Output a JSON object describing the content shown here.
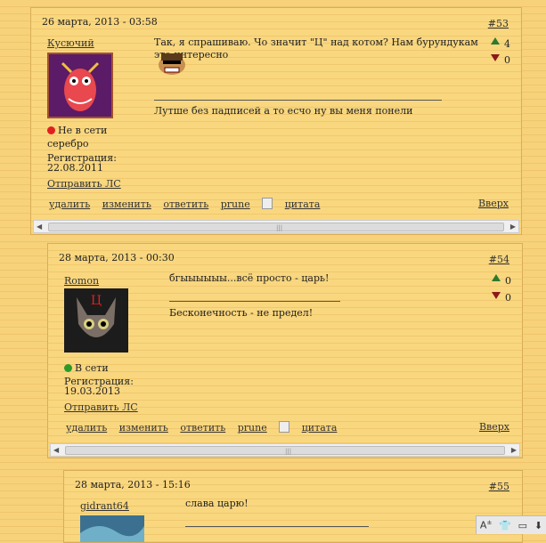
{
  "posts": [
    {
      "date": "26 марта, 2013 - 03:58",
      "number": "#53",
      "author": "Кусючий",
      "status": "Не в сети",
      "status_color": "#e02020",
      "rank": "серебро",
      "reg_label": "Регистрация:",
      "reg_date": "22.08.2011",
      "pm_link": "Отправить ЛС",
      "message": "Так, я спрашиваю. Чо значит \"Ц\" над котом? Нам бурундукам это интересно",
      "signature": "Лутше без падписей а то есчо ну вы меня понели",
      "votes_up": "4",
      "votes_down": "0",
      "actions": [
        "удалить",
        "изменить",
        "ответить",
        "prune",
        "цитата"
      ],
      "top_link": "Вверх"
    },
    {
      "date": "28 марта, 2013 - 00:30",
      "number": "#54",
      "author": "Romon",
      "avatar_letter": "Ц",
      "status": "В сети",
      "status_color": "#2a9a2a",
      "reg_label": "Регистрация:",
      "reg_date": "19.03.2013",
      "pm_link": "Отправить ЛС",
      "message": "бгыыыыыы...всё просто - царь!",
      "signature": "Бесконечность - не предел!",
      "votes_up": "0",
      "votes_down": "0",
      "actions": [
        "удалить",
        "изменить",
        "ответить",
        "prune",
        "цитата"
      ],
      "top_link": "Вверх"
    },
    {
      "date": "28 марта, 2013 - 15:16",
      "number": "#55",
      "author": "gidrant64",
      "message": "слава царю!"
    }
  ],
  "toolbar": {
    "icons": [
      "text-size-icon",
      "shirt-icon",
      "window-icon",
      "download-icon"
    ]
  }
}
